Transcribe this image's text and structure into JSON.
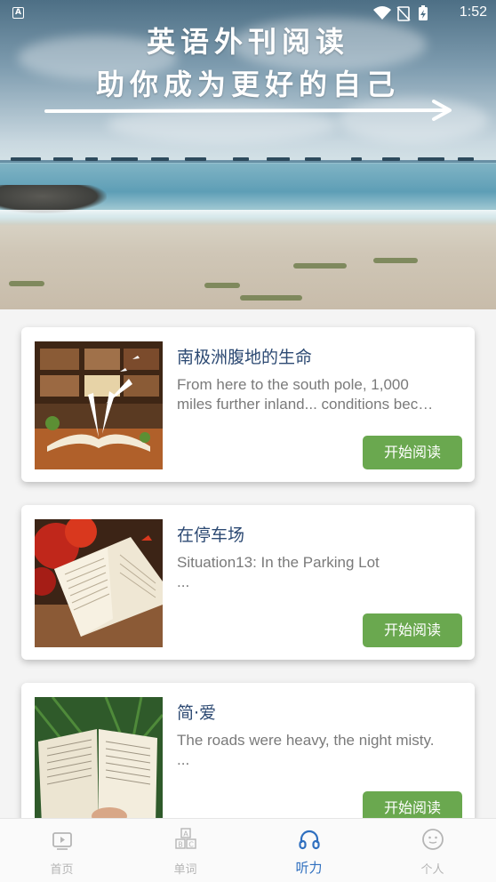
{
  "status_bar": {
    "time": "1:52",
    "indicator": "A"
  },
  "hero": {
    "line1": "英语外刊阅读",
    "line2": "助你成为更好的自己"
  },
  "articles": [
    {
      "title": "南极洲腹地的生命",
      "desc_line1": "From here to the south pole, 1,000",
      "desc_line2": "miles further inland... conditions bec…",
      "button": "开始阅读"
    },
    {
      "title": "在停车场",
      "desc_line1": "Situation13: In the Parking Lot",
      "desc_line2": "...",
      "button": "开始阅读"
    },
    {
      "title": "简·爱",
      "desc_line1": "The roads were heavy, the night misty.",
      "desc_line2": "...",
      "button": "开始阅读"
    }
  ],
  "bottom_nav": [
    {
      "label": "首页",
      "icon": "video-icon"
    },
    {
      "label": "单词",
      "icon": "abc-blocks-icon"
    },
    {
      "label": "听力",
      "icon": "headphones-icon",
      "active": true
    },
    {
      "label": "个人",
      "icon": "smiley-icon"
    }
  ],
  "colors": {
    "accent": "#2f6fbf",
    "button": "#6aa84f",
    "title": "#2d4a73"
  }
}
